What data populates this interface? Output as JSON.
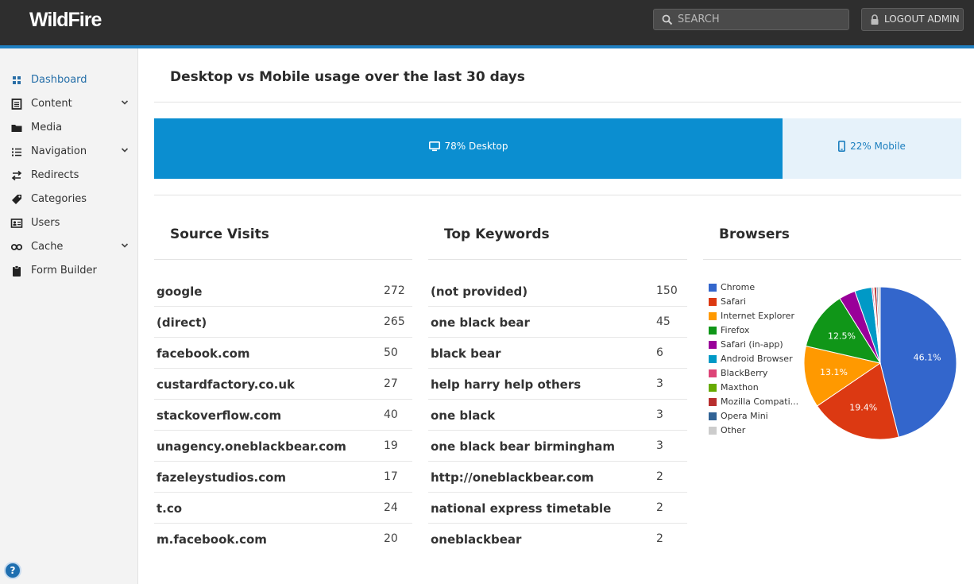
{
  "app": {
    "logo": "WildFire"
  },
  "header": {
    "search_placeholder": "SEARCH",
    "logout_label": "LOGOUT ADMIN"
  },
  "sidebar": {
    "items": [
      {
        "label": "Dashboard",
        "icon": "dashboard-icon",
        "active": true,
        "has_submenu": false
      },
      {
        "label": "Content",
        "icon": "document-icon",
        "active": false,
        "has_submenu": true
      },
      {
        "label": "Media",
        "icon": "folder-icon",
        "active": false,
        "has_submenu": false
      },
      {
        "label": "Navigation",
        "icon": "list-icon",
        "active": false,
        "has_submenu": true
      },
      {
        "label": "Redirects",
        "icon": "redirect-icon",
        "active": false,
        "has_submenu": false
      },
      {
        "label": "Categories",
        "icon": "tag-icon",
        "active": false,
        "has_submenu": false
      },
      {
        "label": "Users",
        "icon": "users-card-icon",
        "active": false,
        "has_submenu": false
      },
      {
        "label": "Cache",
        "icon": "infinity-icon",
        "active": false,
        "has_submenu": true
      },
      {
        "label": "Form Builder",
        "icon": "clipboard-icon",
        "active": false,
        "has_submenu": false
      }
    ],
    "help_label": "?"
  },
  "main": {
    "title": "Desktop vs Mobile usage over the last 30 days",
    "usage": {
      "desktop_percent": 78,
      "desktop_label": "78% Desktop",
      "mobile_percent": 22,
      "mobile_label": "22% Mobile"
    },
    "source_visits": {
      "title": "Source Visits",
      "rows": [
        {
          "name": "google",
          "value": "272"
        },
        {
          "name": "(direct)",
          "value": "265"
        },
        {
          "name": "facebook.com",
          "value": "50"
        },
        {
          "name": "custardfactory.co.uk",
          "value": "27"
        },
        {
          "name": "stackoverflow.com",
          "value": "40"
        },
        {
          "name": "unagency.oneblackbear.com",
          "value": "19"
        },
        {
          "name": "fazeleystudios.com",
          "value": "17"
        },
        {
          "name": "t.co",
          "value": "24"
        },
        {
          "name": "m.facebook.com",
          "value": "20"
        }
      ]
    },
    "top_keywords": {
      "title": "Top Keywords",
      "rows": [
        {
          "name": "(not provided)",
          "value": "150"
        },
        {
          "name": "one black bear",
          "value": "45"
        },
        {
          "name": "black bear",
          "value": "6"
        },
        {
          "name": "help harry help others",
          "value": "3"
        },
        {
          "name": "one black",
          "value": "3"
        },
        {
          "name": "one black bear birmingham",
          "value": "3"
        },
        {
          "name": "http://oneblackbear.com",
          "value": "2"
        },
        {
          "name": "national express timetable",
          "value": "2"
        },
        {
          "name": "oneblackbear",
          "value": "2"
        }
      ]
    },
    "browsers": {
      "title": "Browsers"
    }
  },
  "chart_data": {
    "type": "pie",
    "title": "",
    "legend_position": "left",
    "categories": [
      "Chrome",
      "Safari",
      "Internet Explorer",
      "Firefox",
      "Safari (in-app)",
      "Android Browser",
      "BlackBerry",
      "Maxthon",
      "Mozilla Compati...",
      "Opera Mini",
      "Other"
    ],
    "values": [
      46.1,
      19.4,
      13.1,
      12.5,
      3.5,
      3.6,
      0.3,
      0.2,
      0.5,
      0.3,
      0.5
    ],
    "data_labels": [
      "46.1%",
      "19.4%",
      "13.1%",
      "12.5%",
      "",
      "",
      "",
      "",
      "",
      "",
      ""
    ],
    "colors": [
      "#3366cc",
      "#dc3912",
      "#ff9900",
      "#109618",
      "#990099",
      "#0099c6",
      "#dd4477",
      "#66aa00",
      "#b82e2e",
      "#316395",
      "#cccccc"
    ]
  }
}
